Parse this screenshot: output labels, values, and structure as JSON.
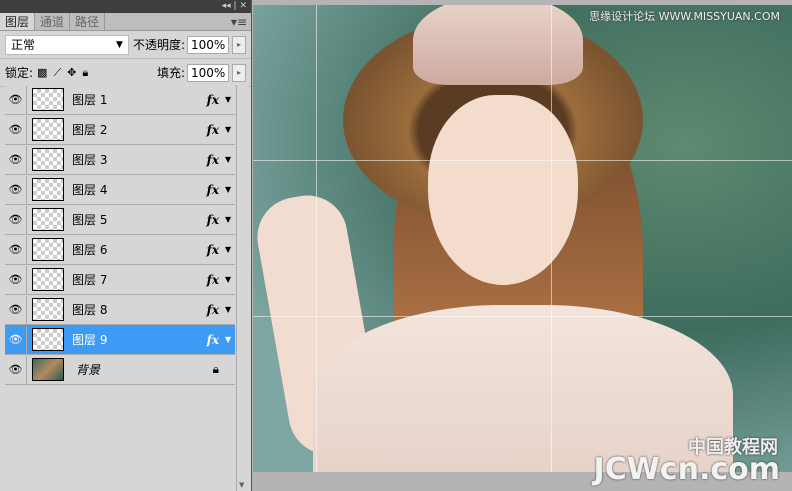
{
  "panel": {
    "tabs": [
      "图层",
      "通道",
      "路径"
    ],
    "blend_mode": "正常",
    "opacity_label": "不透明度:",
    "opacity": "100%",
    "lock_label": "锁定:",
    "fill_label": "填充:",
    "fill": "100%",
    "layers": [
      {
        "name": "图层 1",
        "fx": "fx"
      },
      {
        "name": "图层 2",
        "fx": "fx"
      },
      {
        "name": "图层 3",
        "fx": "fx"
      },
      {
        "name": "图层 4",
        "fx": "fx"
      },
      {
        "name": "图层 5",
        "fx": "fx"
      },
      {
        "name": "图层 6",
        "fx": "fx"
      },
      {
        "name": "图层 7",
        "fx": "fx"
      },
      {
        "name": "图层 8",
        "fx": "fx"
      },
      {
        "name": "图层 9",
        "fx": "fx",
        "selected": true
      },
      {
        "name": "背景",
        "locked": true
      }
    ]
  },
  "canvas": {
    "watermark_top": "思缘设计论坛 WWW.MISSYUAN.COM",
    "watermark_bottom_cn": "中国教程网",
    "watermark_bottom": "JCWcn.com"
  },
  "colors": {
    "selection": "#3d9bf4"
  }
}
